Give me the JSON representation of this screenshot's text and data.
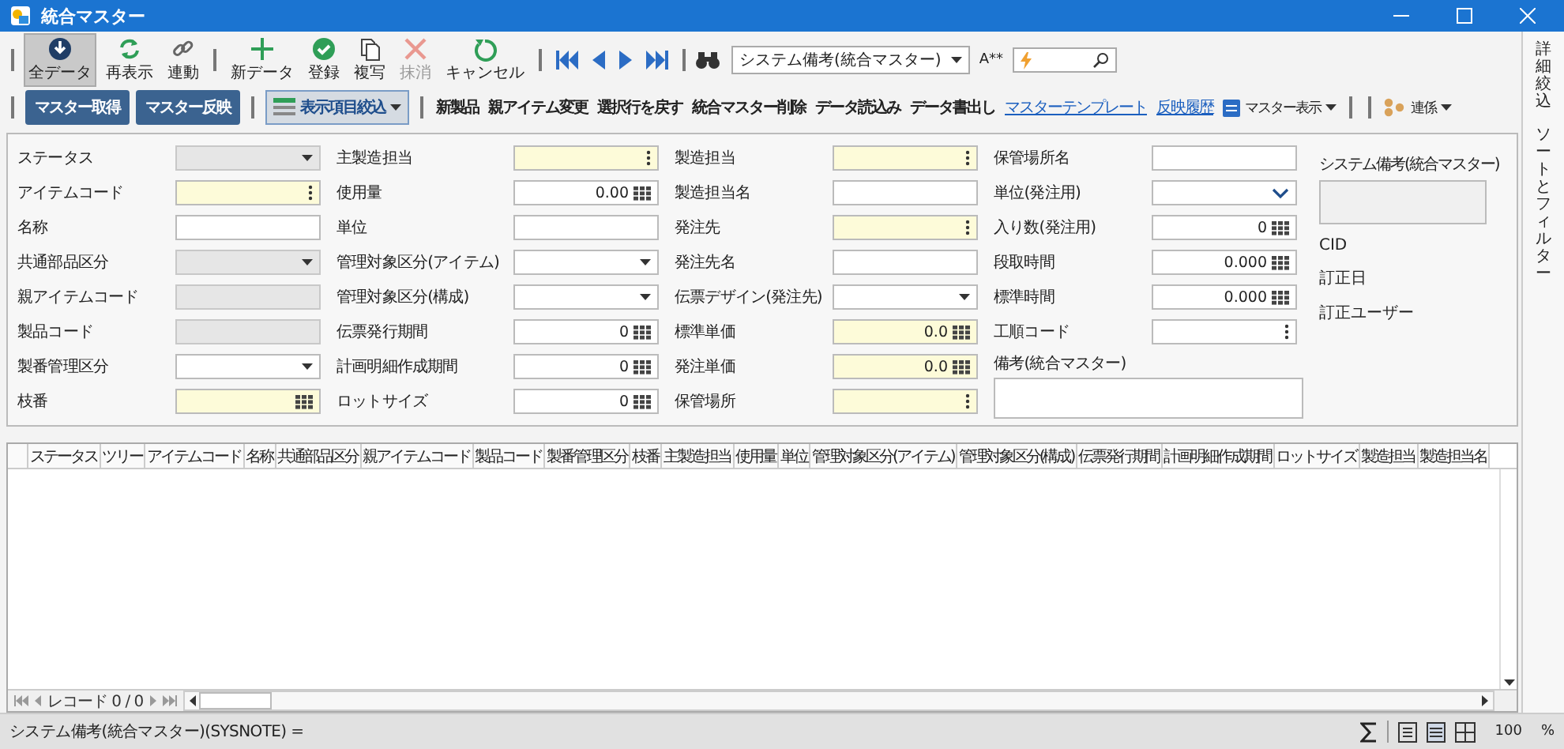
{
  "window": {
    "title": "統合マスター"
  },
  "toolbar": {
    "buttons": [
      {
        "label": "全データ",
        "selected": true,
        "disabled": false
      },
      {
        "label": "再表示",
        "selected": false,
        "disabled": false
      },
      {
        "label": "連動",
        "selected": false,
        "disabled": false
      },
      {
        "label": "新データ",
        "selected": false,
        "disabled": false
      },
      {
        "label": "登録",
        "selected": false,
        "disabled": false
      },
      {
        "label": "複写",
        "selected": false,
        "disabled": false
      },
      {
        "label": "抹消",
        "selected": false,
        "disabled": true
      },
      {
        "label": "キャンセル",
        "selected": false,
        "disabled": false
      }
    ],
    "search_column": {
      "value": "システム備考(統合マスター)"
    },
    "match_label": "A**"
  },
  "commands": [
    {
      "label": "マスター取得",
      "kind": "primary"
    },
    {
      "label": "マスター反映",
      "kind": "primary"
    },
    {
      "label": "表示項目絞込",
      "kind": "filter"
    },
    {
      "label": "新製品",
      "kind": "plain"
    },
    {
      "label": "親アイテム変更",
      "kind": "plain"
    },
    {
      "label": "選択行を戻す",
      "kind": "plain"
    },
    {
      "label": "統合マスター削除",
      "kind": "plain"
    },
    {
      "label": "データ読込み",
      "kind": "plain"
    },
    {
      "label": "データ書出し",
      "kind": "plain"
    },
    {
      "label": "マスターテンプレート",
      "kind": "link"
    },
    {
      "label": "反映履歴",
      "kind": "link"
    },
    {
      "label": "マスター表示",
      "kind": "menu"
    },
    {
      "label": "連係",
      "kind": "menu"
    }
  ],
  "form": {
    "columns": [
      {
        "fields": [
          {
            "label": "ステータス",
            "kind": "dropdown",
            "required": false,
            "disabled": true
          },
          {
            "label": "アイテムコード",
            "kind": "lookup",
            "required": true,
            "disabled": false
          },
          {
            "label": "名称",
            "kind": "text",
            "required": false,
            "disabled": false
          },
          {
            "label": "共通部品区分",
            "kind": "dropdown",
            "required": false,
            "disabled": true
          },
          {
            "label": "親アイテムコード",
            "kind": "text",
            "required": false,
            "disabled": true
          },
          {
            "label": "製品コード",
            "kind": "text",
            "required": false,
            "disabled": true
          },
          {
            "label": "製番管理区分",
            "kind": "dropdown",
            "required": false,
            "disabled": false
          },
          {
            "label": "枝番",
            "kind": "number",
            "required": true,
            "disabled": false
          }
        ]
      },
      {
        "fields": [
          {
            "label": "主製造担当",
            "kind": "lookup",
            "required": true,
            "disabled": false
          },
          {
            "label": "使用量",
            "kind": "number",
            "value": "0.00",
            "required": false,
            "disabled": false
          },
          {
            "label": "単位",
            "kind": "text",
            "required": false,
            "disabled": false
          },
          {
            "label": "管理対象区分(アイテム)",
            "kind": "dropdown",
            "required": false,
            "disabled": false
          },
          {
            "label": "管理対象区分(構成)",
            "kind": "dropdown",
            "required": false,
            "disabled": false
          },
          {
            "label": "伝票発行期間",
            "kind": "number",
            "value": "0",
            "required": false,
            "disabled": false
          },
          {
            "label": "計画明細作成期間",
            "kind": "number",
            "value": "0",
            "required": false,
            "disabled": false
          },
          {
            "label": "ロットサイズ",
            "kind": "number",
            "value": "0",
            "required": false,
            "disabled": false
          }
        ]
      },
      {
        "fields": [
          {
            "label": "製造担当",
            "kind": "lookup",
            "required": true,
            "disabled": false
          },
          {
            "label": "製造担当名",
            "kind": "text",
            "required": false,
            "disabled": false
          },
          {
            "label": "発注先",
            "kind": "lookup",
            "required": true,
            "disabled": false
          },
          {
            "label": "発注先名",
            "kind": "text",
            "required": false,
            "disabled": false
          },
          {
            "label": "伝票デザイン(発注先)",
            "kind": "dropdown",
            "required": false,
            "disabled": false
          },
          {
            "label": "標準単価",
            "kind": "number",
            "value": "0.0",
            "required": true,
            "disabled": false
          },
          {
            "label": "発注単価",
            "kind": "number",
            "value": "0.0",
            "required": true,
            "disabled": false
          },
          {
            "label": "保管場所",
            "kind": "lookup",
            "required": true,
            "disabled": false
          }
        ]
      },
      {
        "fields": [
          {
            "label": "保管場所名",
            "kind": "text",
            "required": false,
            "disabled": false
          },
          {
            "label": "単位(発注用)",
            "kind": "combo",
            "required": false,
            "disabled": false
          },
          {
            "label": "入り数(発注用)",
            "kind": "number",
            "value": "0",
            "required": false,
            "disabled": false
          },
          {
            "label": "段取時間",
            "kind": "number",
            "value": "0.000",
            "required": false,
            "disabled": false
          },
          {
            "label": "標準時間",
            "kind": "number",
            "value": "0.000",
            "required": false,
            "disabled": false
          },
          {
            "label": "工順コード",
            "kind": "lookup",
            "required": false,
            "disabled": false
          },
          {
            "label": "備考(統合マスター)",
            "kind": "memo",
            "required": false,
            "disabled": false
          }
        ]
      }
    ],
    "side": {
      "system_note_label": "システム備考(統合マスター)",
      "info": [
        "CID",
        "訂正日",
        "訂正ユーザー"
      ]
    }
  },
  "grid": {
    "columns": [
      "ステータス",
      "ツリー",
      "アイテムコード",
      "名称",
      "共通部品区分",
      "親アイテムコード",
      "製品コード",
      "製番管理区分",
      "枝番",
      "主製造担当",
      "使用量",
      "単位",
      "管理対象区分(アイテム)",
      "管理対象区分(構成)",
      "伝票発行期間",
      "計画明細作成期間",
      "ロットサイズ",
      "製造担当",
      "製造担当名"
    ],
    "pager": "レコード 0 / 0"
  },
  "status_bar": {
    "text": "システム備考(統合マスター)(SYSNOTE) =",
    "zoom": "100",
    "unit": "%"
  },
  "side_panel": {
    "tabs": [
      {
        "label": "詳細絞込"
      },
      {
        "label": "ソートとフィルター"
      }
    ]
  }
}
